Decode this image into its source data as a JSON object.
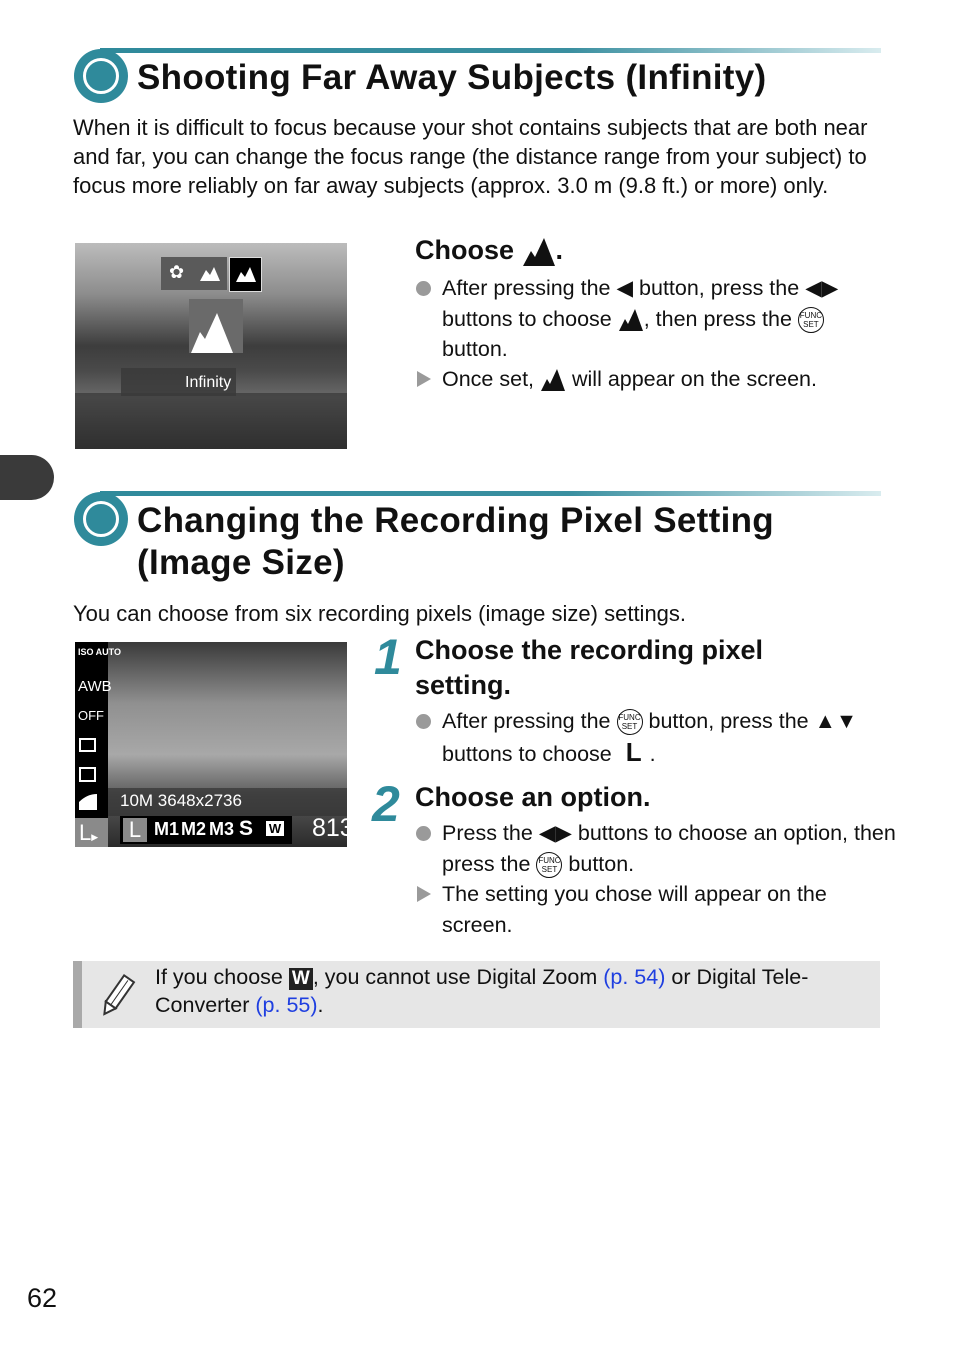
{
  "colors": {
    "accent": "#2f8a9b",
    "link": "#1f3fe0",
    "note_bg": "#e6e6e6"
  },
  "section1": {
    "title": "Shooting Far Away Subjects (Infinity)",
    "intro": "When it is difficult to focus because your shot contains subjects that are both near and far, you can change the focus range (the distance range from your subject) to focus more reliably on far away subjects (approx. 3.0 m (9.8 ft.) or more) only.",
    "photo": {
      "label": "Infinity",
      "icons": [
        "macro-icon",
        "normal-focus-icon",
        "infinity-icon"
      ]
    },
    "step_title": "Choose",
    "step_title_end": ".",
    "bullet1": {
      "a": "After pressing the",
      "b": "button, press the",
      "c": "buttons to choose",
      "d": ", then press the",
      "e": "button."
    },
    "bullet2": {
      "a": "Once set,",
      "b": "will appear on the screen."
    }
  },
  "section2": {
    "title_line1": "Changing the Recording Pixel Setting",
    "title_line2": "(Image Size)",
    "intro": "You can choose from six recording pixels (image size) settings.",
    "photo": {
      "left_icons": [
        "ISO AUTO",
        "AWB",
        "OFF",
        "",
        "",
        "",
        ""
      ],
      "size_info": "10M 3648x2736",
      "options": [
        "L",
        "M1",
        "M2",
        "M3",
        "S",
        "W"
      ],
      "selected": "L",
      "shots": "813",
      "current": "L"
    },
    "step1": {
      "num": "1",
      "title": "Choose the recording pixel setting.",
      "bullet": {
        "a": "After pressing the",
        "b": "button, press the",
        "c": "buttons to choose",
        "d": "."
      }
    },
    "step2": {
      "num": "2",
      "title": "Choose an option.",
      "bullet1": {
        "a": "Press the",
        "b": "buttons to choose an option, then press the",
        "c": "button."
      },
      "bullet2": "The setting you chose will appear on the screen."
    }
  },
  "note": {
    "a": "If you choose",
    "b": ", you cannot use Digital Zoom",
    "link1": "(p. 54)",
    "c": "or Digital Tele-Converter",
    "link2": "(p. 55)",
    "d": "."
  },
  "func_label": {
    "top": "FUNC",
    "bottom": "SET"
  },
  "page_number": "62"
}
